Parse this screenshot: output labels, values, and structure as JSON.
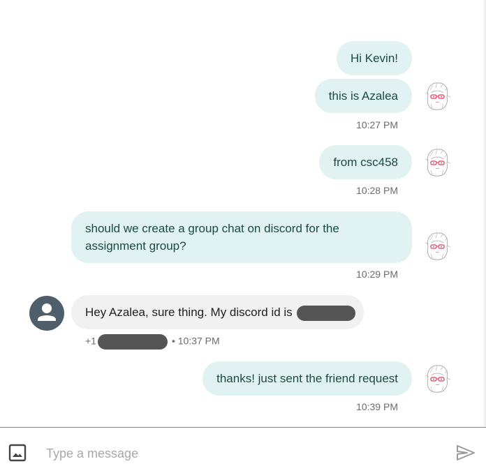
{
  "messages": [
    {
      "text": "Hi Kevin!"
    },
    {
      "text": "this is Azalea",
      "time": "10:27 PM"
    },
    {
      "text": "from csc458",
      "time": "10:28 PM"
    },
    {
      "text": "should we create a group chat on discord for the assignment group?",
      "time": "10:29 PM"
    },
    {
      "text": "Hey Azalea, sure thing. My discord id is",
      "sender_prefix": "+1",
      "time": "• 10:37 PM"
    },
    {
      "text": "thanks! just sent the friend request",
      "time": "10:39 PM"
    }
  ],
  "composer": {
    "placeholder": "Type a message"
  },
  "icons": {
    "attach": "image-icon",
    "send": "send-icon",
    "contact": "person-icon"
  },
  "colors": {
    "outgoing_bubble": "#e0f2f1",
    "incoming_bubble": "#f1f1f1",
    "contact_avatar": "#4e5f6b"
  }
}
